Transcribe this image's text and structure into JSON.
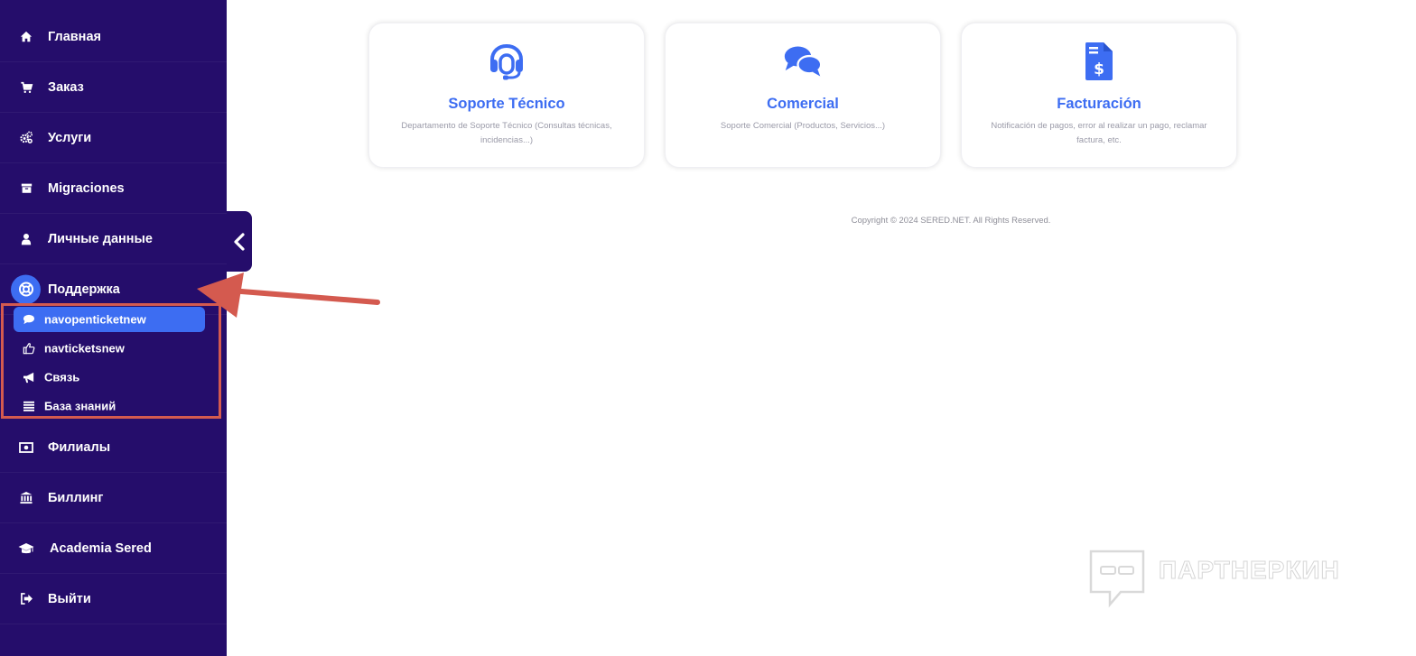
{
  "sidebar": {
    "items": [
      {
        "label": "Главная",
        "icon": "home-icon"
      },
      {
        "label": "Заказ",
        "icon": "cart-icon"
      },
      {
        "label": "Услуги",
        "icon": "gears-icon"
      },
      {
        "label": "Migraciones",
        "icon": "archive-icon"
      },
      {
        "label": "Личные данные",
        "icon": "user-icon"
      },
      {
        "label": "Поддержка",
        "icon": "lifebuoy-icon"
      },
      {
        "label": "Филиалы",
        "icon": "money-icon"
      },
      {
        "label": "Биллинг",
        "icon": "bank-icon"
      },
      {
        "label": "Academia Sered",
        "icon": "graduation-cap-icon"
      },
      {
        "label": "Выйти",
        "icon": "sign-out-icon"
      }
    ],
    "support_submenu": [
      {
        "label": "navopenticketnew",
        "icon": "comment-icon",
        "active": true
      },
      {
        "label": "navticketsnew",
        "icon": "thumbs-up-icon"
      },
      {
        "label": "Связь",
        "icon": "megaphone-icon"
      },
      {
        "label": "База знаний",
        "icon": "list-icon"
      }
    ]
  },
  "cards": [
    {
      "title": "Soporte Técnico",
      "description": "Departamento de Soporte Técnico (Consultas técnicas, incidencias...)",
      "icon": "headset-icon"
    },
    {
      "title": "Comercial",
      "description": "Soporte Comercial (Productos, Servicios...)",
      "icon": "comments-icon"
    },
    {
      "title": "Facturación",
      "description": "Notificación de pagos, error al realizar un pago, reclamar factura, etc.",
      "icon": "invoice-dollar-icon"
    }
  ],
  "footer": {
    "copyright": "Copyright © 2024 SERED.NET. All Rights Reserved."
  },
  "watermark": {
    "text": "ПАРТНЕРКИН"
  },
  "colors": {
    "sidebar": "#250d6b",
    "accent": "#3d6df2",
    "annotation": "#d45a4f"
  }
}
